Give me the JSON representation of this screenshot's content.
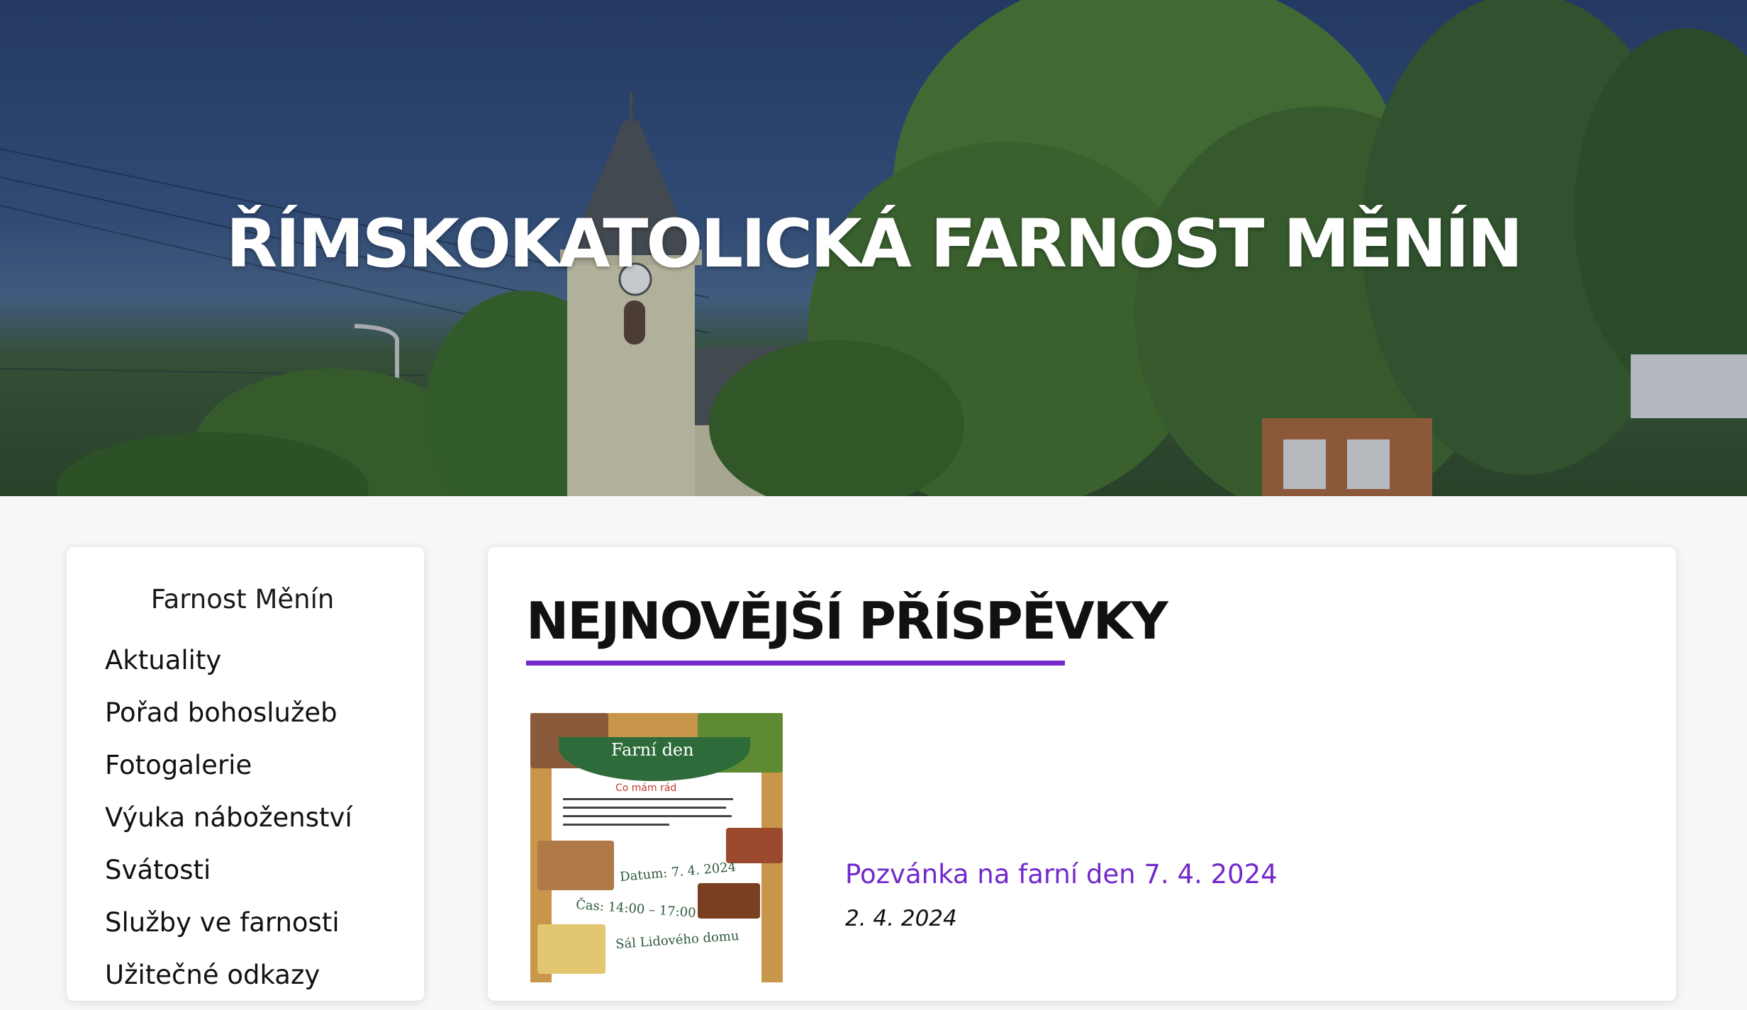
{
  "site": {
    "title": "ŘÍMSKOKATOLICKÁ FARNOST MĚNÍN"
  },
  "sidebar": {
    "title": "Farnost Měnín",
    "items": [
      {
        "label": "Aktuality"
      },
      {
        "label": "Pořad bohoslužeb"
      },
      {
        "label": "Fotogalerie"
      },
      {
        "label": "Výuka náboženství"
      },
      {
        "label": "Svátosti"
      },
      {
        "label": "Služby ve farnosti"
      },
      {
        "label": "Užitečné odkazy"
      }
    ]
  },
  "main": {
    "heading": "NEJNOVĚJŠÍ PŘÍSPĚVKY",
    "posts": [
      {
        "title": "Pozvánka na farní den 7. 4. 2024",
        "date": "2. 4. 2024",
        "poster": {
          "banner": "Farní den",
          "subtitle": "Co mám rád",
          "date_line": "Datum: 7. 4. 2024",
          "time_line": "Čas: 14:00 – 17:00",
          "place_line": "Sál Lidového domu"
        }
      }
    ]
  },
  "colors": {
    "accent": "#7328cc",
    "background": "#f7f7f7"
  }
}
